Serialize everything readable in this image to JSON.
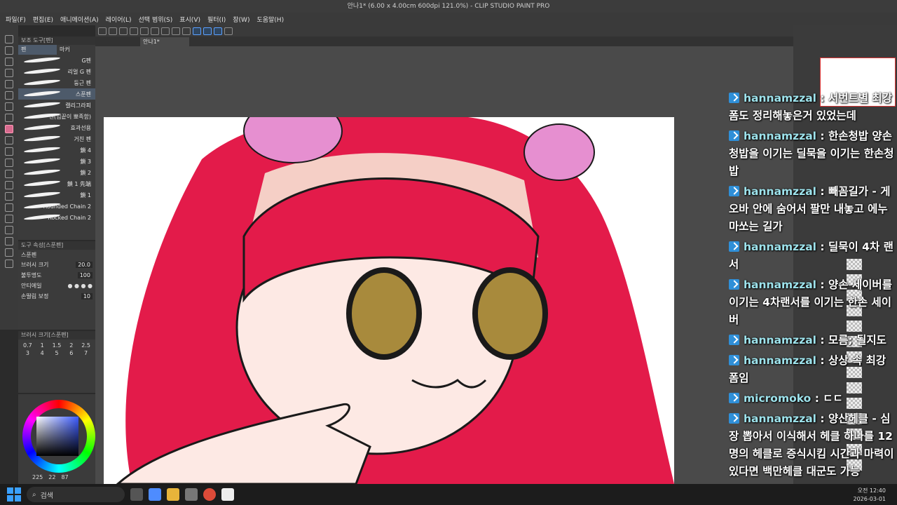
{
  "window": {
    "title": "안나1* (6.00 x 4.00cm 600dpi 121.0%)  - CLIP STUDIO PAINT PRO"
  },
  "menu": [
    "파일(F)",
    "편집(E)",
    "애니메이션(A)",
    "레이어(L)",
    "선택 범위(S)",
    "표시(V)",
    "필터(I)",
    "창(W)",
    "도움말(H)"
  ],
  "document_tab": {
    "label": "안나1*"
  },
  "subtool": {
    "header": "보조 도구[펜]",
    "tabs": [
      "펜",
      "마커"
    ],
    "brushes": [
      "G펜",
      "리얼 G 펜",
      "둥근 펜",
      "스푼펜",
      "캘리그라피",
      "펜(입끝이 뾰족함)",
      "효과선용",
      "거친 펜",
      "鎖 4",
      "鎖 3",
      "鎖 2",
      "鎖 1 先端",
      "鎖 1",
      "Rounded Chain 2",
      "Rocked Chain 2"
    ],
    "selected": "스푼펜"
  },
  "tool_property": {
    "header": "도구 속성[스푼펜]",
    "brush_name": "스푼펜",
    "rows": [
      {
        "label": "브러시 크기",
        "value": "20.0"
      },
      {
        "label": "불투명도",
        "value": "100"
      },
      {
        "label": "안티에일",
        "value": ""
      },
      {
        "label": "손떨림 보정",
        "value": "10"
      }
    ]
  },
  "brush_size": {
    "header": "브러시 크기[스푼펜]",
    "values": [
      "0.7",
      "1",
      "1.5",
      "2",
      "2.5",
      "3",
      "4",
      "5",
      "6",
      "7"
    ]
  },
  "color": {
    "values": [
      "225",
      "22",
      "87"
    ],
    "accent": "#3d5cff"
  },
  "chat": [
    {
      "user": "hannamzzal",
      "text": "서번트별 최강 폼도 정리해놓은거 있었는데"
    },
    {
      "user": "hannamzzal",
      "text": "한손청밥 양손청밥을 이기는 딜묵을 이기는 한손청밥"
    },
    {
      "user": "hannamzzal",
      "text": "빼꼼길가 - 게오바 안에 숨어서 팔만 내놓고 에누마쏘는 길가"
    },
    {
      "user": "hannamzzal",
      "text": "딜묵이 4차 랜서"
    },
    {
      "user": "hannamzzal",
      "text": "양손 세이버를 이기는 4차랜서를 이기는 한손 세이버"
    },
    {
      "user": "hannamzzal",
      "text": "모름; 될지도"
    },
    {
      "user": "hannamzzal",
      "text": "상상 속 최강 폼임"
    },
    {
      "user": "micromoko",
      "text": "ㄷㄷ"
    },
    {
      "user": "hannamzzal",
      "text": "양산헤클 - 심장 뽑아서 이식해서 헤클 하나를 12명의 헤클로 증식시킴 시간과 마력이 있다면 백만헤클 대군도 가능"
    }
  ],
  "taskbar": {
    "search_placeholder": "검색",
    "time": "오전 12:40",
    "date": "2026-03-01"
  }
}
